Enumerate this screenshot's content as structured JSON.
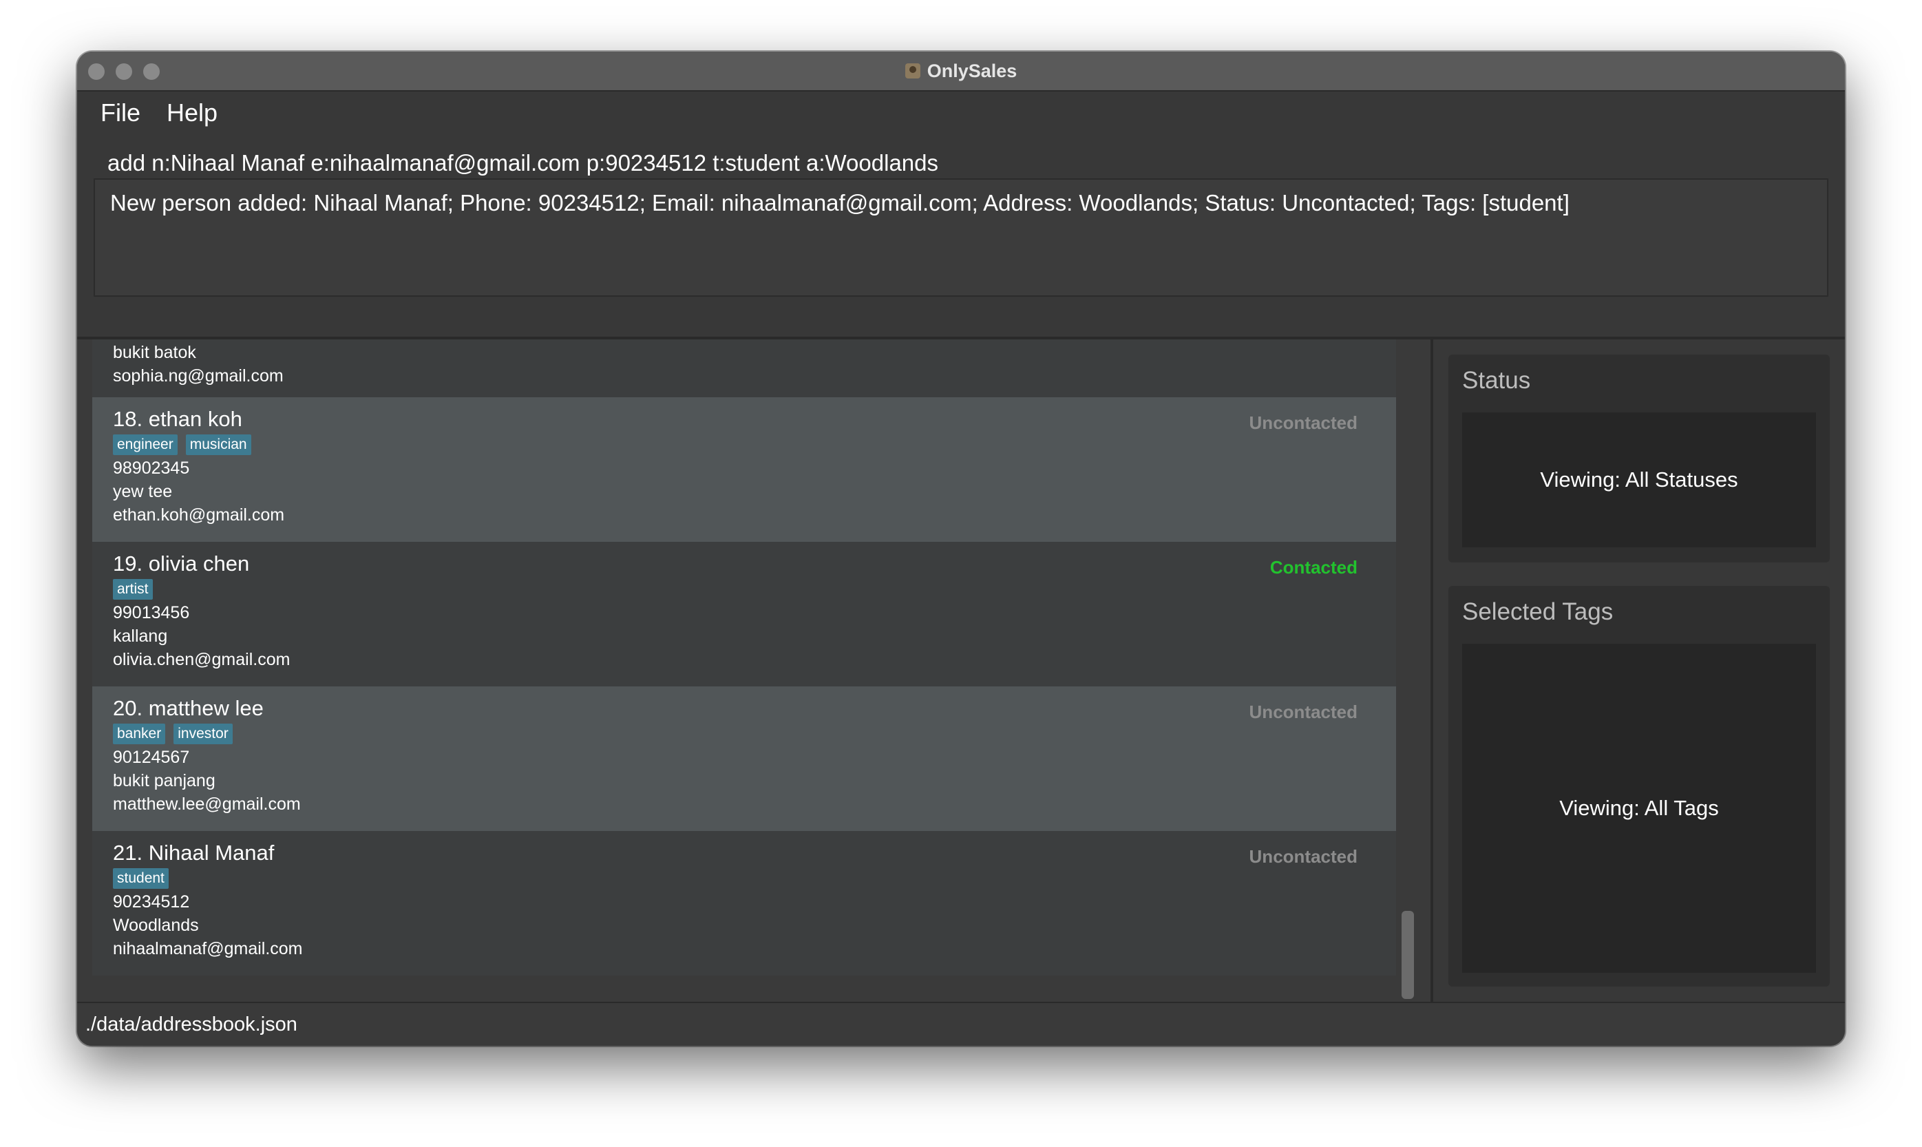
{
  "window": {
    "title": "OnlySales"
  },
  "menu": {
    "file": "File",
    "help": "Help"
  },
  "command": {
    "value": "add n:Nihaal Manaf e:nihaalmanaf@gmail.com p:90234512 t:student a:Woodlands"
  },
  "result": {
    "text": "New person added: Nihaal Manaf; Phone: 90234512; Email: nihaalmanaf@gmail.com; Address: Woodlands; Status: Uncontacted; Tags: [student]"
  },
  "colors": {
    "uncontacted": "#8c8c8c",
    "contacted": "#22c22e",
    "tag": "#3e7b91"
  },
  "persons": [
    {
      "partial": true,
      "address": "bukit batok",
      "email": "sophia.ng@gmail.com"
    },
    {
      "name": "18. ethan koh",
      "tags": [
        "engineer",
        "musician"
      ],
      "phone": "98902345",
      "address": "yew tee",
      "email": "ethan.koh@gmail.com",
      "status": "Uncontacted"
    },
    {
      "name": "19. olivia chen",
      "tags": [
        "artist"
      ],
      "phone": "99013456",
      "address": "kallang",
      "email": "olivia.chen@gmail.com",
      "status": "Contacted"
    },
    {
      "name": "20. matthew lee",
      "tags": [
        "banker",
        "investor"
      ],
      "phone": "90124567",
      "address": "bukit panjang",
      "email": "matthew.lee@gmail.com",
      "status": "Uncontacted"
    },
    {
      "name": "21. Nihaal Manaf",
      "tags": [
        "student"
      ],
      "phone": "90234512",
      "address": "Woodlands",
      "email": "nihaalmanaf@gmail.com",
      "status": "Uncontacted"
    }
  ],
  "status_panel": {
    "title": "Status",
    "value": "Viewing: All Statuses"
  },
  "tags_panel": {
    "title": "Selected Tags",
    "value": "Viewing: All Tags"
  },
  "footer": {
    "path": "./data/addressbook.json"
  }
}
